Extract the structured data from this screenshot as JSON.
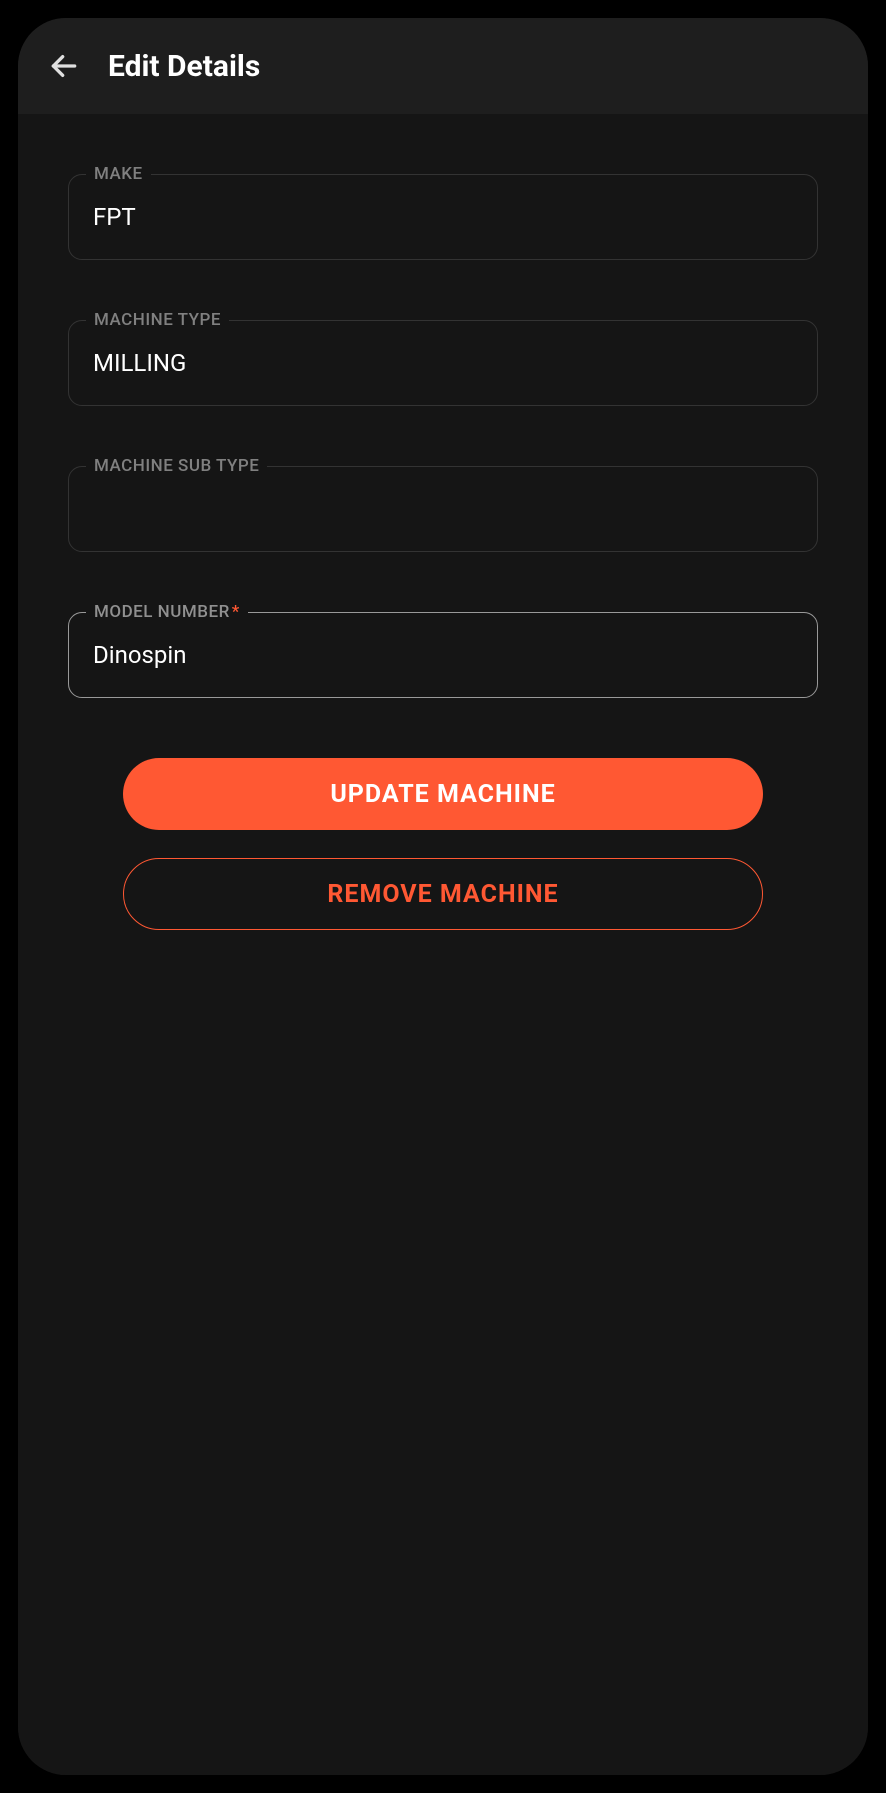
{
  "header": {
    "title": "Edit Details"
  },
  "fields": {
    "make": {
      "label": "MAKE",
      "value": "FPT",
      "required": false
    },
    "machine_type": {
      "label": "MACHINE TYPE",
      "value": "MILLING",
      "required": false
    },
    "machine_sub_type": {
      "label": "MACHINE SUB TYPE",
      "value": "",
      "required": false
    },
    "model_number": {
      "label": "MODEL NUMBER",
      "value": "Dinospin",
      "required": true
    }
  },
  "buttons": {
    "update": "UPDATE MACHINE",
    "remove": "REMOVE MACHINE"
  },
  "colors": {
    "accent": "#ff5833",
    "background": "#151515",
    "header_bg": "#1e1e1e",
    "border": "#333333",
    "text": "#ffffff",
    "label": "#808080"
  }
}
